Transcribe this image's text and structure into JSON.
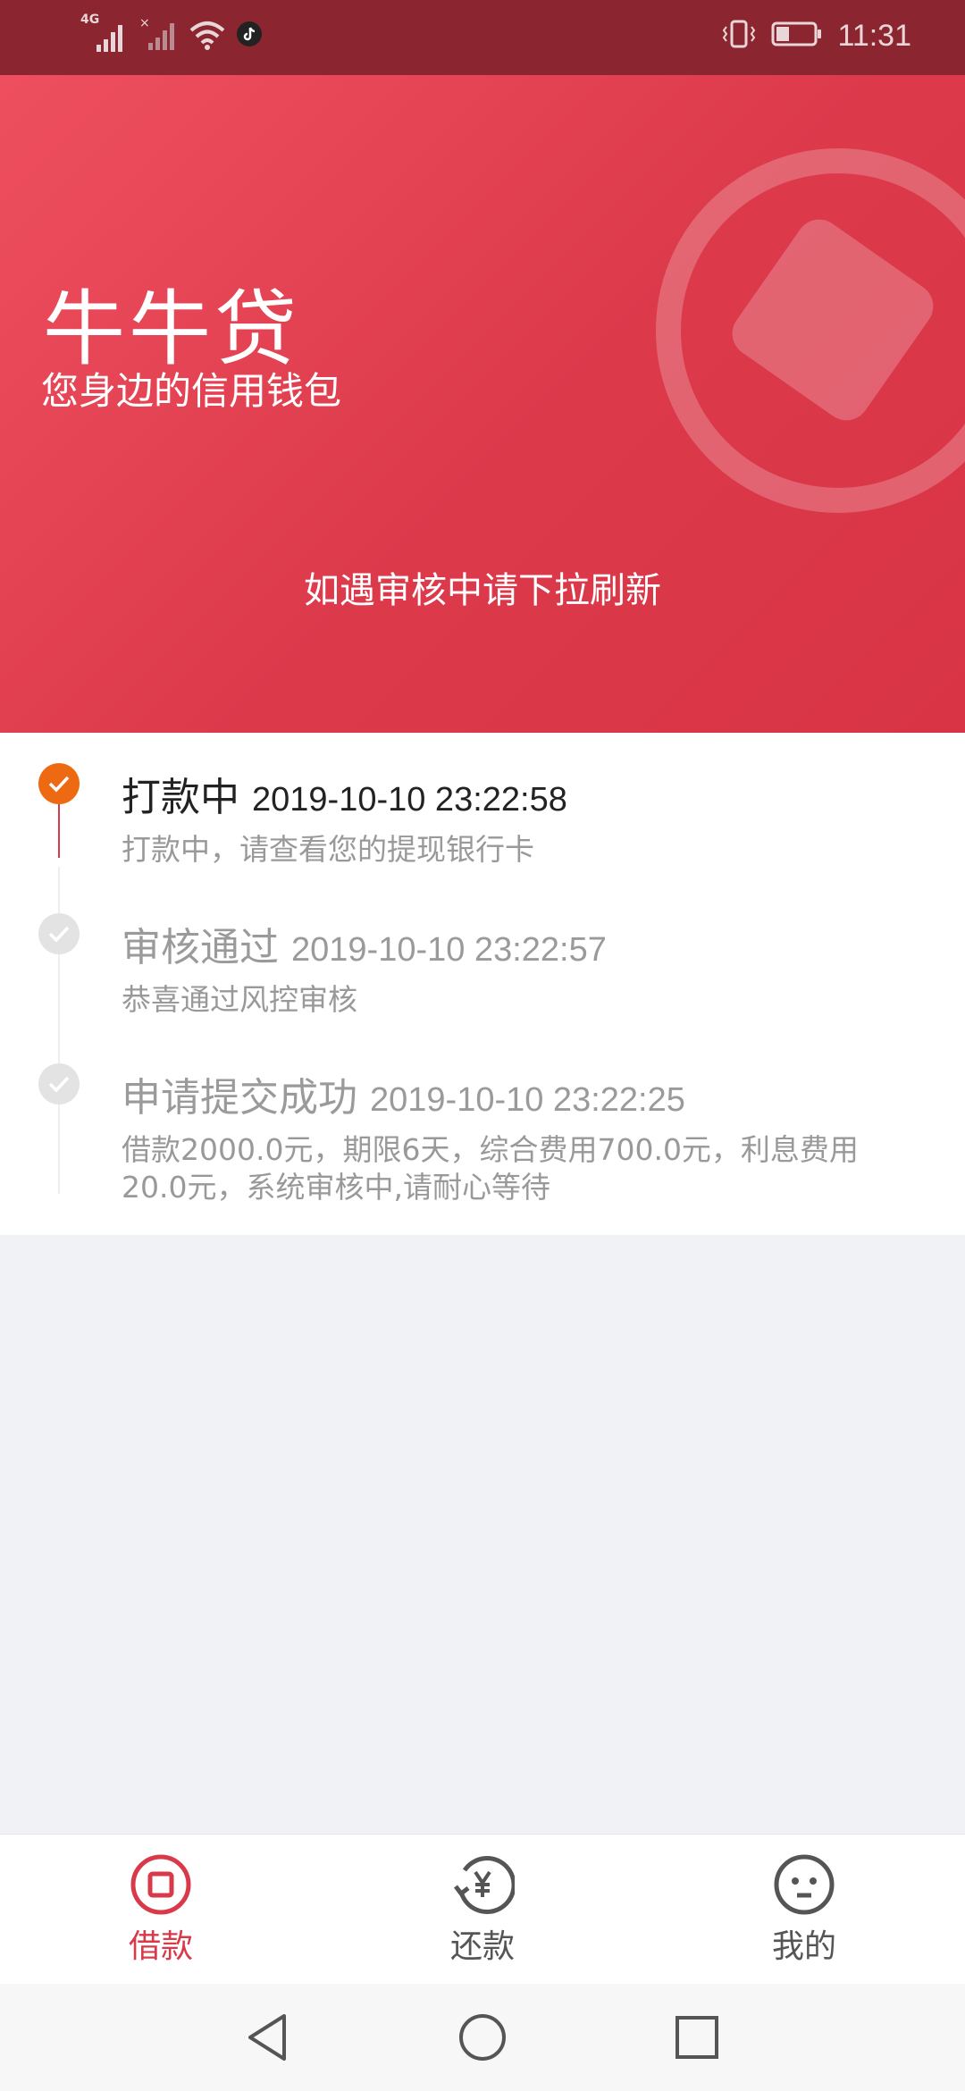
{
  "status_bar": {
    "network_label": "4G",
    "time": "11:31"
  },
  "header": {
    "title": "牛牛贷",
    "subtitle": "您身边的信用钱包",
    "refresh_hint": "如遇审核中请下拉刷新"
  },
  "timeline": {
    "steps": [
      {
        "title": "打款中",
        "time": "2019-10-10 23:22:58",
        "desc": "打款中，请查看您的提现银行卡",
        "state": "active"
      },
      {
        "title": "审核通过",
        "time": "2019-10-10 23:22:57",
        "desc": "恭喜通过风控审核",
        "state": "done"
      },
      {
        "title": "申请提交成功",
        "time": "2019-10-10 23:22:25",
        "desc": "借款2000.0元，期限6天，综合费用700.0元，利息费用20.0元，系统审核中,请耐心等待",
        "state": "done"
      }
    ]
  },
  "bottom_nav": {
    "items": [
      {
        "label": "借款",
        "icon": "loan-icon",
        "active": true
      },
      {
        "label": "还款",
        "icon": "repay-icon",
        "active": false
      },
      {
        "label": "我的",
        "icon": "profile-icon",
        "active": false
      }
    ]
  },
  "colors": {
    "status_bar": "#8b2630",
    "header_start": "#ee4f5e",
    "header_end": "#d83446",
    "accent": "#d83a4a",
    "active_dot": "#ee6a12",
    "inactive_dot": "#e3e3e3",
    "page_bg": "#f1f2f6"
  }
}
